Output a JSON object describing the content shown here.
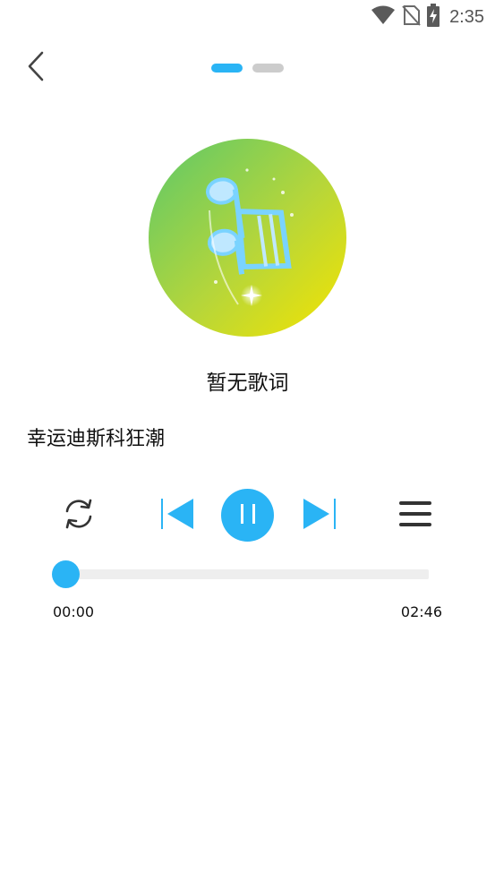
{
  "status_bar": {
    "time": "2:35",
    "icons": [
      "wifi-icon",
      "no-sim-icon",
      "battery-charging-icon"
    ]
  },
  "header": {
    "back_icon": "chevron-left-icon",
    "pages": [
      {
        "active": true
      },
      {
        "active": false
      }
    ]
  },
  "colors": {
    "accent": "#2ab4f5",
    "inactive_dot": "#cccccc",
    "track": "#eeeeee",
    "icon_dark": "#333333",
    "art_gradient_start": "#5cc86a",
    "art_gradient_end": "#f5e400"
  },
  "player": {
    "lyrics": "暂无歌词",
    "song_title": "幸运迪斯科狂潮",
    "current_time": "00:00",
    "total_time": "02:46",
    "progress": 0,
    "state": "playing"
  },
  "controls": {
    "repeat_icon": "repeat-icon",
    "prev_icon": "skip-previous-icon",
    "play_pause_icon": "pause-icon",
    "next_icon": "skip-next-icon",
    "playlist_icon": "playlist-menu-icon"
  }
}
